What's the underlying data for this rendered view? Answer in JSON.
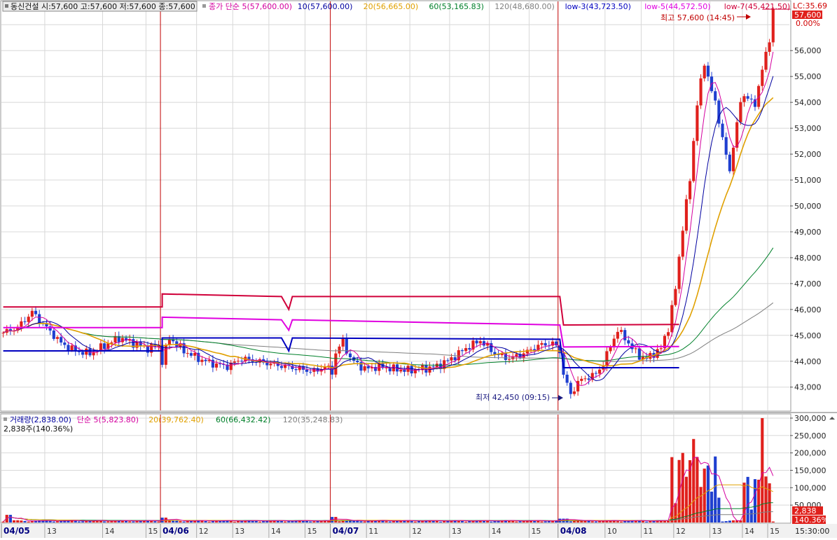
{
  "price_panel": {
    "title_box": "동신건설 시:57,600 고:57,600 저:57,600 종:57,600",
    "legend": [
      {
        "text": "종가 단순 5(57,600.00)",
        "color": "#d4009f"
      },
      {
        "text": "10(57,600.00)",
        "color": "#0000a0"
      },
      {
        "text": "20(56,665.00)",
        "color": "#e0a000"
      },
      {
        "text": "60(53,165.83)",
        "color": "#00802a"
      },
      {
        "text": "120(48,680.00)",
        "color": "#808080"
      },
      {
        "text": "low-3(43,723.50)",
        "color": "#0000c0"
      },
      {
        "text": "low-5(44,572.50)",
        "color": "#e000e0"
      },
      {
        "text": "low-7(45,421.50)",
        "color": "#d0003a"
      }
    ],
    "lc_label": "LC:35.69",
    "current_price_label": "57,600",
    "current_pct_label": "0.00%",
    "high_annotation": "최고 57,600 (14:45)",
    "low_annotation": "최저 42,450 (09:15)"
  },
  "volume_panel": {
    "legend": [
      {
        "text": "거래량(2,838.00)",
        "color": "#0000a0"
      },
      {
        "text": "단순 5(5,823.80)",
        "color": "#d4009f"
      },
      {
        "text": "20(39,762.40)",
        "color": "#e0a000"
      },
      {
        "text": "60(66,432.42)",
        "color": "#00802a"
      },
      {
        "text": "120(35,248.83)",
        "color": "#808080"
      }
    ],
    "sub_label": "2,838주(140.36%)",
    "current_volume_label": "2,838",
    "current_pct_label": "140.36%"
  },
  "x_axis": {
    "day_labels": [
      "04/05",
      "04/06",
      "04/07",
      "04/08"
    ],
    "hour_labels": [
      "13",
      "14",
      "15"
    ],
    "hour_labels_full": [
      "10",
      "11",
      "12",
      "13",
      "14",
      "15"
    ],
    "time_label": "15:30:00"
  },
  "colors": {
    "up": "#e0201c",
    "down": "#1f3fd0",
    "ma5": "#d4009f",
    "ma10": "#0000a0",
    "ma20": "#e0a000",
    "ma60": "#00802a",
    "ma120": "#808080",
    "low3": "#0000c0",
    "low5": "#e000e0",
    "low7": "#d0003a",
    "grid": "#d8d8d8",
    "day_sep": "#c00000"
  },
  "chart_data": {
    "type": "candlestick",
    "title": "동신건설",
    "ylim": [
      42100,
      57900
    ],
    "y_ticks": [
      43000,
      44000,
      45000,
      46000,
      47000,
      48000,
      49000,
      50000,
      51000,
      52000,
      53000,
      54000,
      55000,
      56000,
      57000
    ],
    "volume_ylim": [
      0,
      310000
    ],
    "volume_ticks": [
      50000,
      100000,
      150000,
      200000,
      250000,
      300000
    ],
    "open": 57600,
    "high": 57600,
    "low": 57600,
    "close": 57600,
    "day_high": {
      "value": 57600,
      "time": "14:45"
    },
    "day_low": {
      "value": 42450,
      "time": "09:15"
    },
    "price_path": [
      [
        0,
        45100
      ],
      [
        4,
        45300
      ],
      [
        8,
        45900
      ],
      [
        12,
        45300
      ],
      [
        16,
        44700
      ],
      [
        20,
        44400
      ],
      [
        24,
        44300
      ],
      [
        28,
        44600
      ],
      [
        32,
        44900
      ],
      [
        36,
        44700
      ],
      [
        40,
        44500
      ],
      [
        43,
        44600
      ],
      [
        44,
        44000
      ],
      [
        46,
        44900
      ],
      [
        50,
        44400
      ],
      [
        54,
        44100
      ],
      [
        58,
        43900
      ],
      [
        62,
        43800
      ],
      [
        66,
        44100
      ],
      [
        70,
        44000
      ],
      [
        74,
        43900
      ],
      [
        78,
        43800
      ],
      [
        82,
        43700
      ],
      [
        86,
        43600
      ],
      [
        89,
        43800
      ],
      [
        91,
        43600
      ],
      [
        92,
        44300
      ],
      [
        94,
        44800
      ],
      [
        96,
        44100
      ],
      [
        100,
        43700
      ],
      [
        104,
        43800
      ],
      [
        108,
        43700
      ],
      [
        112,
        43650
      ],
      [
        116,
        43700
      ],
      [
        120,
        43800
      ],
      [
        124,
        44100
      ],
      [
        128,
        44500
      ],
      [
        132,
        44800
      ],
      [
        136,
        44300
      ],
      [
        140,
        44100
      ],
      [
        144,
        44300
      ],
      [
        148,
        44600
      ],
      [
        152,
        44700
      ],
      [
        154,
        44400
      ],
      [
        155,
        43500
      ],
      [
        157,
        42700
      ],
      [
        159,
        43200
      ],
      [
        162,
        43400
      ],
      [
        164,
        43500
      ],
      [
        166,
        43900
      ],
      [
        168,
        44600
      ],
      [
        170,
        45200
      ],
      [
        172,
        44900
      ],
      [
        174,
        44500
      ],
      [
        176,
        44200
      ],
      [
        178,
        44100
      ],
      [
        180,
        44300
      ],
      [
        182,
        44500
      ],
      [
        184,
        45300
      ],
      [
        186,
        46800
      ],
      [
        188,
        49200
      ],
      [
        190,
        51000
      ],
      [
        192,
        54000
      ],
      [
        194,
        55500
      ],
      [
        196,
        54500
      ],
      [
        198,
        53300
      ],
      [
        200,
        52000
      ],
      [
        201,
        51200
      ],
      [
        202,
        52400
      ],
      [
        204,
        54000
      ],
      [
        206,
        54300
      ],
      [
        208,
        53800
      ],
      [
        209,
        54600
      ],
      [
        210,
        55400
      ],
      [
        212,
        56300
      ],
      [
        213,
        57600
      ]
    ],
    "low3_path": [
      [
        0,
        44400
      ],
      [
        44,
        44400
      ],
      [
        44,
        44900
      ],
      [
        77,
        44900
      ],
      [
        79,
        44400
      ],
      [
        80,
        44900
      ],
      [
        154,
        44850
      ],
      [
        155,
        43750
      ],
      [
        187,
        43750
      ]
    ],
    "low5_path": [
      [
        0,
        45300
      ],
      [
        44,
        45300
      ],
      [
        44,
        45700
      ],
      [
        77,
        45600
      ],
      [
        79,
        45200
      ],
      [
        80,
        45600
      ],
      [
        154,
        45400
      ],
      [
        155,
        44550
      ],
      [
        187,
        44570
      ]
    ],
    "low7_path": [
      [
        0,
        46100
      ],
      [
        44,
        46100
      ],
      [
        44,
        46600
      ],
      [
        77,
        46500
      ],
      [
        79,
        46000
      ],
      [
        80,
        46500
      ],
      [
        154,
        46500
      ],
      [
        155,
        45400
      ],
      [
        187,
        45420
      ]
    ],
    "ma_endpoints": {
      "ma5": 57600,
      "ma10": 57600,
      "ma20": 56665,
      "ma60": 53165.83,
      "ma120": 48680
    },
    "volume_summary": {
      "last_volume": 2838,
      "ratio_pct": 140.36,
      "max_volume": 300000
    }
  }
}
